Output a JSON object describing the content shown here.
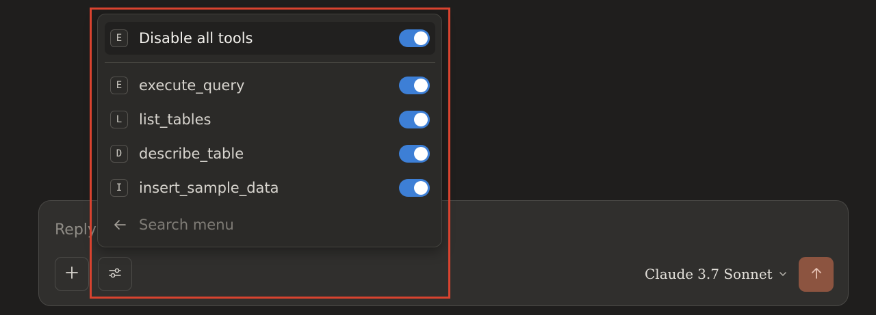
{
  "composer": {
    "placeholder": "Reply to Claude...",
    "add_icon": "plus-icon",
    "tools_icon": "sliders-icon",
    "model": {
      "name": "Claude",
      "version": "3.7 Sonnet",
      "chevron_icon": "chevron-down-icon"
    },
    "send_icon": "arrow-up-icon",
    "send_color": "#8c5440"
  },
  "tools_menu": {
    "disable_all": {
      "letter": "E",
      "label": "Disable all tools",
      "enabled": true
    },
    "items": [
      {
        "letter": "E",
        "label": "execute_query",
        "enabled": true
      },
      {
        "letter": "L",
        "label": "list_tables",
        "enabled": true
      },
      {
        "letter": "D",
        "label": "describe_table",
        "enabled": true
      },
      {
        "letter": "I",
        "label": "insert_sample_data",
        "enabled": true
      }
    ],
    "search": {
      "placeholder": "Search menu",
      "back_icon": "arrow-left-icon"
    },
    "toggle_color": "#3d7fd6"
  },
  "highlight_color": "#d9432f"
}
